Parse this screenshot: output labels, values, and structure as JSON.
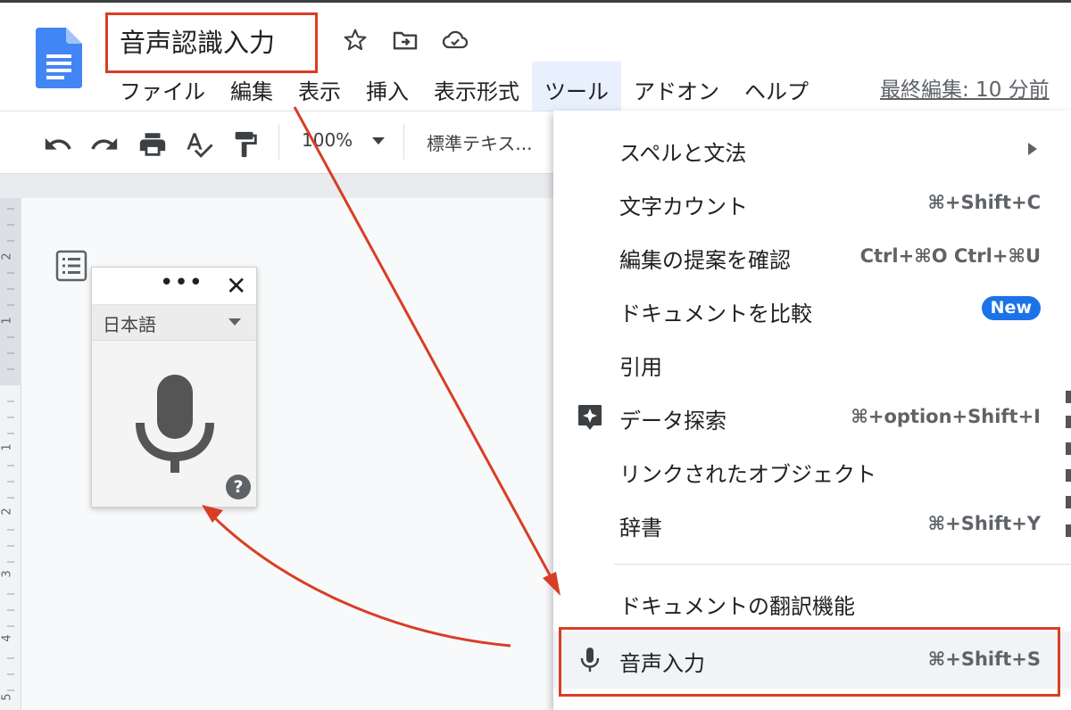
{
  "header": {
    "title": "音声認識入力",
    "last_edit": "最終編集: 10 分前"
  },
  "menubar": {
    "items": [
      "ファイル",
      "編集",
      "表示",
      "挿入",
      "表示形式",
      "ツール",
      "アドオン",
      "ヘルプ"
    ],
    "active": "ツール"
  },
  "toolbar": {
    "zoom": "100%",
    "style": "標準テキス..."
  },
  "voice_panel": {
    "language": "日本語",
    "help": "?"
  },
  "ruler_left_numbers": [
    "2",
    "1",
    "1",
    "2",
    "3",
    "4",
    "5"
  ],
  "tools_menu": {
    "spelling": {
      "label": "スペルと文法"
    },
    "word_count": {
      "label": "文字カウント",
      "shortcut": "⌘+Shift+C"
    },
    "review_suggestions": {
      "label": "編集の提案を確認",
      "shortcut": "Ctrl+⌘O Ctrl+⌘U"
    },
    "compare": {
      "label": "ドキュメントを比較",
      "badge": "New"
    },
    "citations": {
      "label": "引用"
    },
    "explore": {
      "label": "データ探索",
      "shortcut": "⌘+option+Shift+I"
    },
    "linked_objects": {
      "label": "リンクされたオブジェクト"
    },
    "dictionary": {
      "label": "辞書",
      "shortcut": "⌘+Shift+Y"
    },
    "translate": {
      "label": "ドキュメントの翻訳機能"
    },
    "voice_typing": {
      "label": "音声入力",
      "shortcut": "⌘+Shift+S"
    }
  },
  "colors": {
    "annotation_red": "#d93d25",
    "docs_blue": "#4285f4",
    "badge_blue": "#1a73e8",
    "menu_active": "#e8f0fe"
  }
}
